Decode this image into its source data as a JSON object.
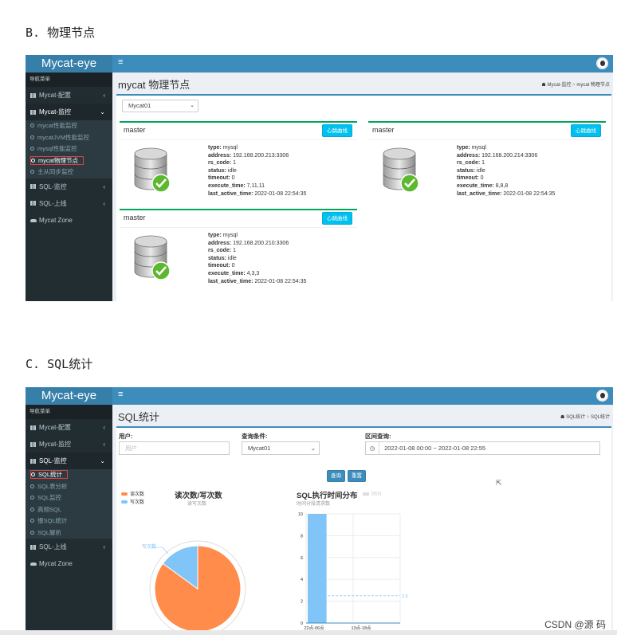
{
  "sections": {
    "b_prefix": "B.",
    "b_title": "物理节点",
    "c_prefix": "C.",
    "c_title_a": "SQL",
    "c_title_b": "统计"
  },
  "app": {
    "logo": "Mycat-eye",
    "hamburger": "≡",
    "nav_header": "导航菜单"
  },
  "sidebar1": {
    "items": [
      {
        "label": "Mycat-配置"
      },
      {
        "label": "Mycat-监控"
      },
      {
        "label": "SQL-监控"
      },
      {
        "label": "SQL-上线"
      },
      {
        "label": "Mycat Zone"
      }
    ],
    "subs": [
      "mycat性能监控",
      "mycatJVM性能监控",
      "mysql性能监控",
      "mycat物理节点",
      "主从同步监控"
    ]
  },
  "page1": {
    "title": "mycat 物理节点",
    "crumb_home": "Mycat-监控",
    "crumb_sep": ">",
    "crumb_current": "mycat 物理节点",
    "select_value": "Mycat01",
    "heartbeat_label": "心跳曲线",
    "nodes": [
      {
        "title": "master",
        "type": "mysql",
        "address": "192.168.200.213:3306",
        "rs_code": "1",
        "status": "idle",
        "timeout": "0",
        "execute_time": "7,11,11",
        "last_active_time": "2022-01-08 22:54:35"
      },
      {
        "title": "master",
        "type": "mysql",
        "address": "192.168.200.214:3306",
        "rs_code": "1",
        "status": "idle",
        "timeout": "0",
        "execute_time": "8,8,8",
        "last_active_time": "2022-01-08 22:54:35"
      },
      {
        "title": "master",
        "type": "mysql",
        "address": "192.168.200.210:3306",
        "rs_code": "1",
        "status": "idle",
        "timeout": "0",
        "execute_time": "4,3,3",
        "last_active_time": "2022-01-08 22:54:35"
      }
    ],
    "field_labels": {
      "type": "type:",
      "address": "address:",
      "rs_code": "rs_code:",
      "status": "status:",
      "timeout": "timeout:",
      "execute_time": "execute_time:",
      "last_active_time": "last_active_time:"
    }
  },
  "sidebar2": {
    "items": [
      {
        "label": "Mycat-配置"
      },
      {
        "label": "Mycat-监控"
      },
      {
        "label": "SQL-监控"
      },
      {
        "label": "SQL-上线"
      },
      {
        "label": "Mycat Zone"
      }
    ],
    "subs": [
      "SQL统计",
      "SQL表分析",
      "SQL监控",
      "高频SQL",
      "慢SQL统计",
      "SQL解析"
    ]
  },
  "page2": {
    "title": "SQL统计",
    "crumb_home": "SQL统计",
    "crumb_sep": ">",
    "crumb_current": "SQL统计",
    "user_label": "用户:",
    "user_placeholder": "用户",
    "cond_label": "查询条件:",
    "cond_value": "Mycat01",
    "range_label": "区间查询:",
    "range_value": "2022-01-08 00:00 ~ 2022-01-08 22:55",
    "query_btn": "查询",
    "reset_btn": "重置"
  },
  "colors": {
    "read": "#ff8c4b",
    "write": "#80c4f8",
    "primary": "#3c8dbc",
    "sidebar": "#222d32"
  },
  "chart_data": [
    {
      "type": "pie",
      "title": "读次数/写次数",
      "subtitle": "读写次数",
      "legend": [
        "读次数",
        "写次数"
      ],
      "slice_labels": [
        "读次数",
        "写次数"
      ],
      "series": [
        {
          "name": "读次数",
          "values": [
            85
          ]
        },
        {
          "name": "写次数",
          "values": [
            15
          ]
        }
      ],
      "categories": [
        "读次数",
        "写次数"
      ],
      "values": [
        85,
        15
      ]
    },
    {
      "type": "bar",
      "title": "SQL执行时间分布",
      "subtitle": "时间分段请求数",
      "legend": [
        "时间"
      ],
      "categories": [
        "22点-06点",
        "13点-18点"
      ],
      "values": [
        10,
        0
      ],
      "ylim": [
        0,
        10
      ],
      "yticks": [
        0,
        2,
        4,
        6,
        8,
        10
      ],
      "markline": {
        "value": 2.5,
        "label": "2.5"
      }
    }
  ],
  "footer": {
    "watermark": "CSDN @源  码"
  }
}
